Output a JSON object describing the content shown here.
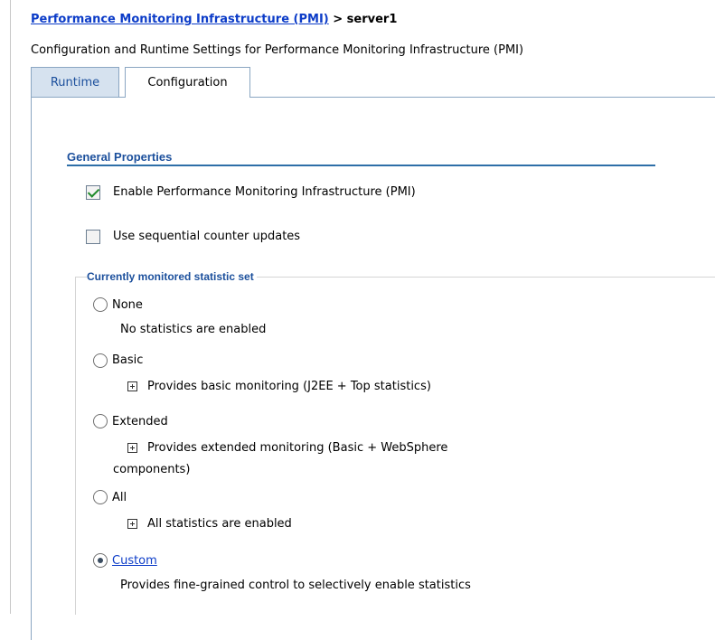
{
  "breadcrumb": {
    "link": "Performance Monitoring Infrastructure (PMI)",
    "separator": " > ",
    "current": "server1"
  },
  "description": "Configuration and Runtime Settings for Performance Monitoring Infrastructure (PMI)",
  "tabs": [
    {
      "label": "Runtime"
    },
    {
      "label": "Configuration"
    }
  ],
  "general_properties": {
    "title": "General Properties",
    "enable_pmi": {
      "label": "Enable Performance Monitoring Infrastructure (PMI)",
      "checked": true
    },
    "sequential": {
      "label": "Use sequential counter updates",
      "checked": false
    }
  },
  "statistic_set": {
    "legend": "Currently monitored statistic set",
    "options": [
      {
        "label": "None",
        "selected": false,
        "description": "No statistics are enabled"
      },
      {
        "label": "Basic",
        "selected": false,
        "description": "Provides basic monitoring (J2EE + Top statistics)"
      },
      {
        "label": "Extended",
        "selected": false,
        "description_line1": "Provides extended monitoring (Basic + WebSphere",
        "description_line2": "components)"
      },
      {
        "label": "All",
        "selected": false,
        "description": "All statistics are enabled"
      },
      {
        "label": "Custom",
        "selected": true,
        "description": "Provides fine-grained control to selectively enable statistics"
      }
    ]
  },
  "colors": {
    "link": "#0c3cc8",
    "accent": "#1b4f9c",
    "rule": "#2e6fa8",
    "check": "#1f8a2a"
  }
}
